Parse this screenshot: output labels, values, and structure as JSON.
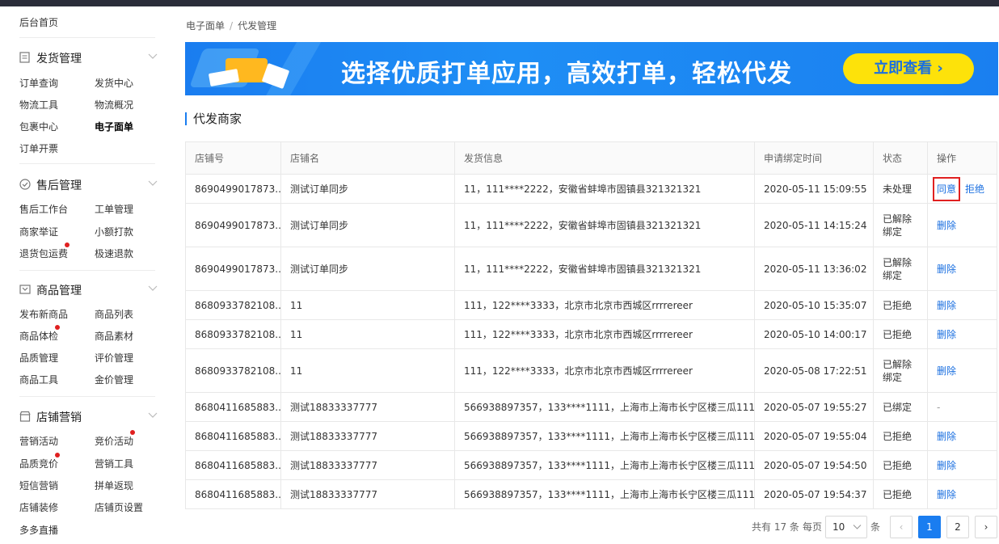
{
  "sidebar": {
    "home": "后台首页",
    "sections": [
      {
        "title": "发货管理",
        "icon": "document-icon",
        "items": [
          "订单查询",
          "发货中心",
          "物流工具",
          "物流概况",
          "包裹中心",
          "电子面单",
          "订单开票"
        ]
      },
      {
        "title": "售后管理",
        "icon": "shield-check-icon",
        "items": [
          "售后工作台",
          "工单管理",
          "商家举证",
          "小额打款",
          "退货包运费",
          "极速退款"
        ]
      },
      {
        "title": "商品管理",
        "icon": "product-box-icon",
        "items": [
          "发布新商品",
          "商品列表",
          "商品体检",
          "商品素材",
          "品质管理",
          "评价管理",
          "商品工具",
          "金价管理"
        ]
      },
      {
        "title": "店铺营销",
        "icon": "store-icon",
        "items": [
          "营销活动",
          "竞价活动",
          "品质竞价",
          "营销工具",
          "短信营销",
          "拼单返现",
          "店铺装修",
          "店铺页设置",
          "多多直播"
        ]
      }
    ]
  },
  "breadcrumb": {
    "root": "电子面单",
    "sep": "/",
    "current": "代发管理"
  },
  "banner": {
    "text": "选择优质打单应用，高效打单，轻松代发",
    "button": "立即查看 ›"
  },
  "section_title": "代发商家",
  "table": {
    "headers": [
      "店铺号",
      "店铺名",
      "发货信息",
      "申请绑定时间",
      "状态",
      "操作"
    ],
    "rows": [
      {
        "shop_id": "8690499017873...",
        "shop_name": "测试订单同步",
        "info": "11，111****2222，安徽省蚌埠市固镇县321321321",
        "time": "2020-05-11 15:09:55",
        "status": "未处理",
        "ops": [
          "同意",
          "拒绝"
        ]
      },
      {
        "shop_id": "8690499017873...",
        "shop_name": "测试订单同步",
        "info": "11，111****2222，安徽省蚌埠市固镇县321321321",
        "time": "2020-05-11 14:15:24",
        "status": "已解除绑定",
        "ops": [
          "删除"
        ]
      },
      {
        "shop_id": "8690499017873...",
        "shop_name": "测试订单同步",
        "info": "11，111****2222，安徽省蚌埠市固镇县321321321",
        "time": "2020-05-11 13:36:02",
        "status": "已解除绑定",
        "ops": [
          "删除"
        ]
      },
      {
        "shop_id": "8680933782108...",
        "shop_name": "11",
        "info": "111，122****3333，北京市北京市西城区rrrrereer",
        "time": "2020-05-10 15:35:07",
        "status": "已拒绝",
        "ops": [
          "删除"
        ]
      },
      {
        "shop_id": "8680933782108...",
        "shop_name": "11",
        "info": "111，122****3333，北京市北京市西城区rrrrereer",
        "time": "2020-05-10 14:00:17",
        "status": "已拒绝",
        "ops": [
          "删除"
        ]
      },
      {
        "shop_id": "8680933782108...",
        "shop_name": "11",
        "info": "111，122****3333，北京市北京市西城区rrrrereer",
        "time": "2020-05-08 17:22:51",
        "status": "已解除绑定",
        "ops": [
          "删除"
        ]
      },
      {
        "shop_id": "8680411685883...",
        "shop_name": "测试18833337777",
        "info": "566938897357，133****1111，上海市上海市长宁区楼三瓜111",
        "time": "2020-05-07 19:55:27",
        "status": "已绑定",
        "ops": [
          "-"
        ]
      },
      {
        "shop_id": "8680411685883...",
        "shop_name": "测试18833337777",
        "info": "566938897357，133****1111，上海市上海市长宁区楼三瓜111",
        "time": "2020-05-07 19:55:04",
        "status": "已拒绝",
        "ops": [
          "删除"
        ]
      },
      {
        "shop_id": "8680411685883...",
        "shop_name": "测试18833337777",
        "info": "566938897357，133****1111，上海市上海市长宁区楼三瓜111",
        "time": "2020-05-07 19:54:50",
        "status": "已拒绝",
        "ops": [
          "删除"
        ]
      },
      {
        "shop_id": "8680411685883...",
        "shop_name": "测试18833337777",
        "info": "566938897357，133****1111，上海市上海市长宁区楼三瓜111",
        "time": "2020-05-07 19:54:37",
        "status": "已拒绝",
        "ops": [
          "删除"
        ]
      }
    ]
  },
  "pagination": {
    "total_text": "共有 17 条",
    "per_page_label": "每页",
    "per_page": "10",
    "unit": "条",
    "prev": "‹",
    "next": "›",
    "pages": [
      "1",
      "2"
    ],
    "current": "1"
  }
}
